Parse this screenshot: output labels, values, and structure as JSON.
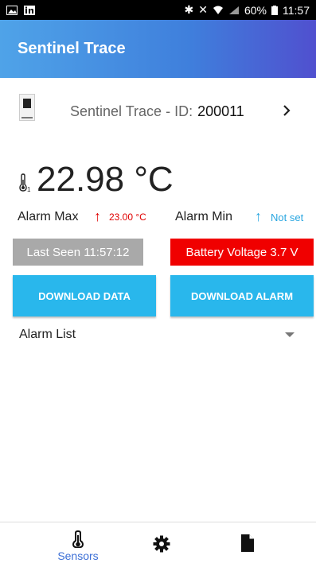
{
  "status_bar": {
    "battery_percent": "60%",
    "time": "11:57"
  },
  "app_bar": {
    "title": "Sentinel Trace"
  },
  "device": {
    "label": "Sentinel Trace - ID:",
    "id": "200011",
    "chevron": "›",
    "icon": "device-icon"
  },
  "temperature": {
    "value": "22.98 °C",
    "sensor_icon": "thermometer-icon"
  },
  "alarms": {
    "max_label": "Alarm Max",
    "max_value": "23.00 °C",
    "min_label": "Alarm Min",
    "min_value": "Not set",
    "max_color": "#e00000",
    "min_color": "#29a6e0"
  },
  "status": {
    "last_seen": "Last Seen 11:57:12",
    "battery_voltage": "Battery Voltage 3.7 V",
    "battery_color": "#f00000",
    "last_seen_color": "#a9a9a9"
  },
  "buttons": {
    "download_data": "DOWNLOAD DATA",
    "download_alarm": "DOWNLOAD ALARM",
    "accent": "#29b7ec"
  },
  "alarm_list": {
    "label": "Alarm List"
  },
  "bottom_nav": {
    "sensors_label": "Sensors",
    "sensors_icon": "thermometer-icon",
    "settings_icon": "gear-icon",
    "file_icon": "document-icon"
  }
}
